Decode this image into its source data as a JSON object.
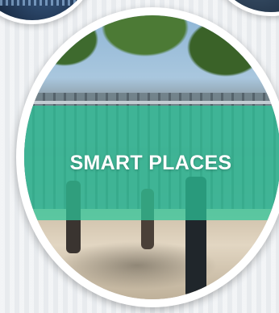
{
  "tile": {
    "title": "SMART PLACES",
    "banner_color": "#2dc89b",
    "border_color": "#ffffff"
  }
}
